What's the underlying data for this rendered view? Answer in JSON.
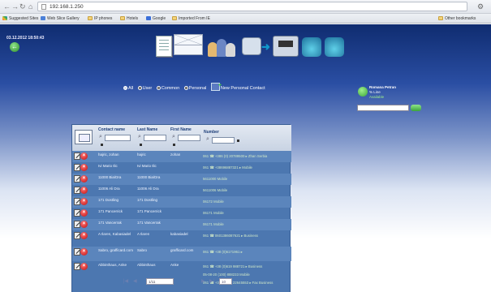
{
  "browser": {
    "url": "192.168.1.250",
    "bookmarks": [
      "Suggested Sites",
      "Web Slice Gallery",
      "IP phones",
      "Hotels",
      "Google",
      "Imported From IE"
    ],
    "other_bookmarks": "Other bookmarks"
  },
  "app": {
    "datetime": "03.12.2012 18:50:43",
    "filters": [
      "All",
      "User",
      "Common",
      "Personal"
    ],
    "selected_filter": "All",
    "new_contact_label": "New Personal Contact",
    "status": {
      "name": "Romana Petran",
      "line2": "% Line",
      "state": "Available"
    },
    "columns": {
      "contact": "Contact name",
      "last": "Last Name",
      "first": "First Name",
      "number": "Number"
    },
    "pagination": {
      "page_text": "1/11",
      "page_size": "10"
    }
  },
  "rows": [
    {
      "contact": "hajric, zohan",
      "last": "hajric",
      "first": "zohan",
      "phones": [
        "061  ☎ +386 (0) 20789500  ▸ Zhan Serbia"
      ]
    },
    {
      "contact": "Ivi Mario Ilic",
      "last": "Ivi Mario Ilic",
      "first": "",
      "phones": [
        "061  ☎ +38696887321  ▸ Mobile"
      ]
    },
    {
      "contact": "11000 Bia/Dra",
      "last": "11000 Bia/Dra",
      "first": "",
      "phones": [
        "5611000  Mobile"
      ]
    },
    {
      "contact": "11006 Ali Dra",
      "last": "11006 Ali Dra",
      "first": "",
      "phones": [
        "5611006  Mobile"
      ]
    },
    {
      "contact": "171 Dostling",
      "last": "171 Dostling",
      "first": "",
      "phones": [
        "06172  Mobile"
      ]
    },
    {
      "contact": "171 Pancerrick",
      "last": "171 Pancerrick",
      "first": "",
      "phones": [
        "06171  Mobile"
      ]
    },
    {
      "contact": "171 Vancerrak",
      "last": "171 Vancerrak",
      "first": "",
      "phones": [
        "06171  Mobile"
      ]
    },
    {
      "contact": "A Ilaren, Kabasiadel",
      "last": "A Ilaren",
      "first": "kabasiadel",
      "phones": [
        "061  ☎ 0601386087621  ▸ Business"
      ]
    },
    {
      "contact": "Sabro, grafficard.com",
      "last": "Sabro",
      "first": "grafficard.com",
      "phones": [
        "061  ☎ +38 (0)6171961  ▸"
      ]
    },
    {
      "contact": "Abbinthaus, Anke",
      "last": "Abbinthaus",
      "first": "Anke",
      "phones": [
        "061  ☎ +38 (0)619 988721  ▸ Business",
        "05-08-20 (100) 888233  Mobile",
        "061  ☎ +38 (0)721 22645553  ▸ Fax Business"
      ]
    }
  ]
}
